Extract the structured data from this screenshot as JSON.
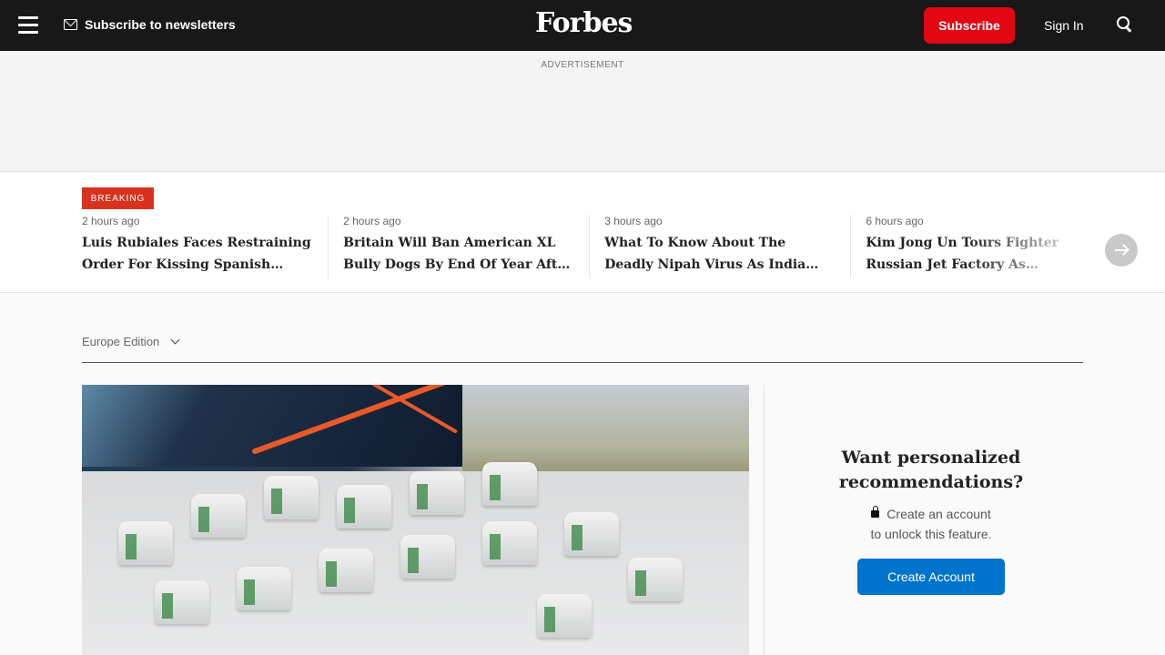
{
  "header": {
    "newsletter_label": "Subscribe to newsletters",
    "logo_text": "Forbes",
    "subscribe_label": "Subscribe",
    "signin_label": "Sign In"
  },
  "ad": {
    "label": "ADVERTISEMENT"
  },
  "breaking": {
    "tag": "BREAKING",
    "stories": [
      {
        "time": "2 hours ago",
        "headline": "Luis Rubiales Faces Restraining Order For Kissing Spanish Soccer Star"
      },
      {
        "time": "2 hours ago",
        "headline": "Britain Will Ban American XL Bully Dogs By End Of Year After Recent Attacks"
      },
      {
        "time": "3 hours ago",
        "headline": "What To Know About The Deadly Nipah Virus As India Races To Contain Outbreak"
      },
      {
        "time": "6 hours ago",
        "headline": "Kim Jong Un Tours Fighter Russian Jet Factory As Worries Grow Of Arms Deal"
      }
    ]
  },
  "edition": {
    "label": "Europe Edition"
  },
  "sidebar": {
    "title": "Want personalized recommendations?",
    "text_line1": "Create an account",
    "text_line2": "to unlock this feature.",
    "button_label": "Create Account"
  },
  "colors": {
    "brand_red": "#e30613",
    "breaking_red": "#d8321f",
    "accent_blue": "#0073cc",
    "nav_bg": "#181818"
  }
}
